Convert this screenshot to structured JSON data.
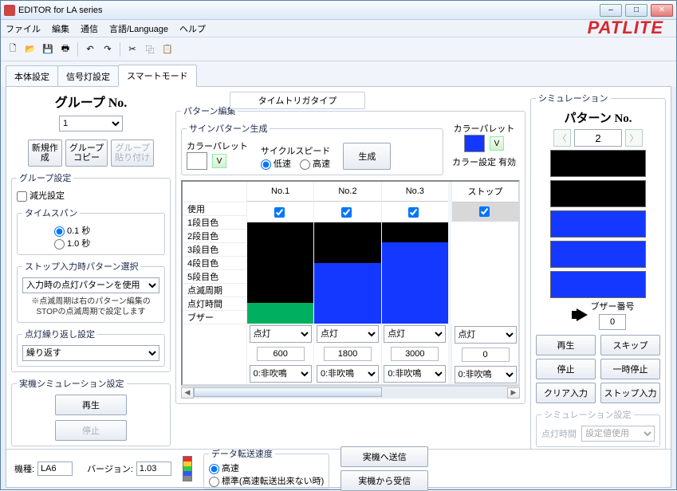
{
  "window": {
    "title": "EDITOR for LA series"
  },
  "menu": {
    "file": "ファイル",
    "edit": "編集",
    "comm": "通信",
    "lang": "言語/Language",
    "help": "ヘルプ"
  },
  "brand": "PATLITE",
  "tabs": {
    "t1": "本体設定",
    "t2": "信号灯設定",
    "t3": "スマートモード"
  },
  "mid_banner": "タイムトリガタイプ",
  "left": {
    "group_no_title": "グループ No.",
    "group_no_value": "1",
    "btn_new": "新規作\n成",
    "btn_copy": "グループ\nコピー",
    "btn_paste": "グループ\n貼り付け",
    "fs_group": "グループ設定",
    "chk_dim": "減光設定",
    "fs_timespan": "タイムスパン",
    "rb_01": "0.1 秒",
    "rb_10": "1.0 秒",
    "fs_stopsel": "ストップ入力時パターン選択",
    "sel_stopsel": "入力時の点灯パターンを使用",
    "note": "※点滅周期は右のパターン編集の\nSTOPの点滅周期で設定します",
    "fs_repeat": "点灯繰り返し設定",
    "sel_repeat": "繰り返す",
    "fs_machine": "実機シミュレーション設定",
    "btn_play": "再生",
    "btn_stop": "停止"
  },
  "mid": {
    "fs_pattern": "パターン編集",
    "fs_sign": "サインパターン生成",
    "lbl_palette": "カラーパレット",
    "lbl_cycle": "サイクルスピード",
    "rb_slow": "低速",
    "rb_fast": "高速",
    "btn_gen": "生成",
    "palette_color": "#e20000",
    "right_palette_color": "#1438ff",
    "lbl_palette_state": "カラー設定 有効",
    "grid": {
      "col1": "No.1",
      "col2": "No.2",
      "col3": "No.3",
      "stop": "ストップ",
      "row_use": "使用",
      "row_c1": "1段目色",
      "row_c2": "2段目色",
      "row_c3": "3段目色",
      "row_c4": "4段目色",
      "row_c5": "5段目色",
      "row_blink": "点滅周期",
      "row_time": "点灯時間",
      "row_buzzer": "ブザー",
      "sel_lit": "点灯",
      "time1": "600",
      "time2": "1800",
      "time3": "3000",
      "time_stop": "0",
      "buzz_none": "0:非吹鳴",
      "colors": {
        "c1": [
          "#000000",
          "#000000",
          "#000000"
        ],
        "c2": [
          "#000000",
          "#000000",
          "#1438ff"
        ],
        "c3": [
          "#000000",
          "#1438ff",
          "#1438ff"
        ],
        "c4": [
          "#000000",
          "#1438ff",
          "#1438ff"
        ],
        "c5": [
          "#00b060",
          "#1438ff",
          "#1438ff"
        ]
      }
    }
  },
  "right": {
    "fs_sim": "シミュレーション",
    "pattern_no_title": "パターン No.",
    "pattern_no_value": "2",
    "tower": [
      "#000000",
      "#000000",
      "#1438ff",
      "#1438ff",
      "#1438ff"
    ],
    "lbl_buzzer_no": "ブザー番号",
    "buzzer_no": "0",
    "btn_play": "再生",
    "btn_skip": "スキップ",
    "btn_stop": "停止",
    "btn_pause": "一時停止",
    "btn_clear": "クリア入力",
    "btn_stopinput": "ストップ入力",
    "fs_simset": "シミュレーション設定",
    "lbl_littime": "点灯時間",
    "sel_littime": "設定値使用"
  },
  "bottom": {
    "lbl_model": "機種:",
    "model": "LA6",
    "lbl_version": "バージョン:",
    "version": "1.03",
    "fs_speed": "データ転送速度",
    "rb_high": "高速",
    "rb_std": "標準(高速転送出来ない時)",
    "btn_send": "実機へ送信",
    "btn_recv": "実機から受信"
  },
  "icons": {
    "minimize": "–",
    "maximize": "□",
    "close": "✕",
    "new": "🗋",
    "open": "📂",
    "save": "💾",
    "print": "🖶",
    "cut": "✂",
    "copy": "⿻",
    "paste": "📋",
    "undo": "↶",
    "redo": "↷",
    "prev": "〈",
    "next": "〉",
    "dropdown": "V"
  }
}
